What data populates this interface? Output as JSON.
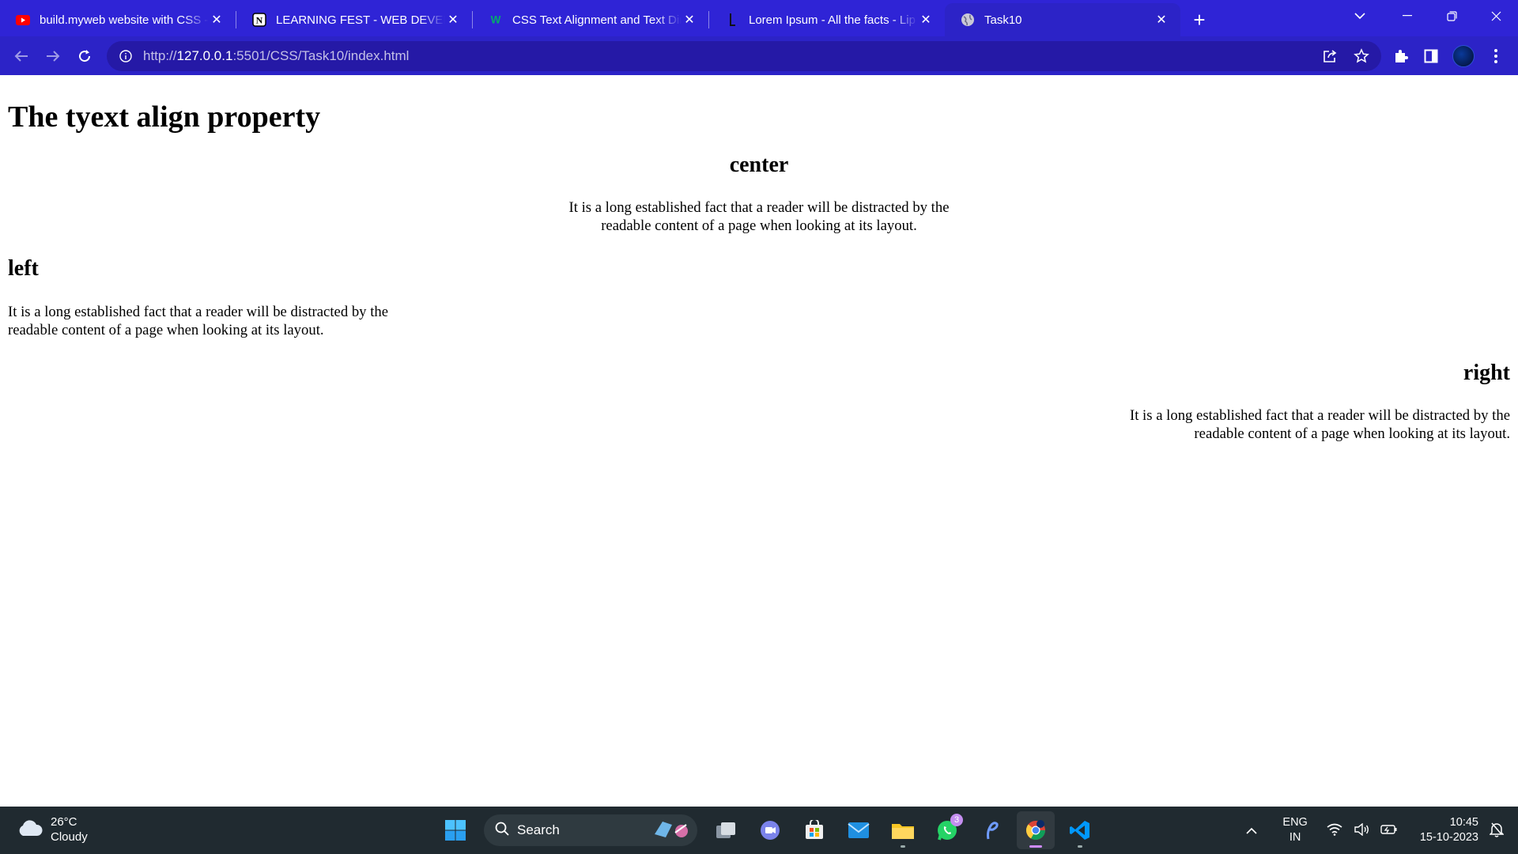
{
  "browser": {
    "tabs": [
      {
        "title": "build.myweb website with CSS -",
        "favicon": "youtube-icon"
      },
      {
        "title": "LEARNING FEST - WEB DEVELOPER",
        "favicon": "notion-icon"
      },
      {
        "title": "CSS Text Alignment and Text Dir",
        "favicon": "w3schools-icon"
      },
      {
        "title": "Lorem Ipsum - All the facts - Lip",
        "favicon": "lipsum-icon"
      },
      {
        "title": "Task10",
        "favicon": "globe-icon",
        "active": true
      }
    ],
    "url_host": "127.0.0.1",
    "url_scheme": "http://",
    "url_rest": ":5501/CSS/Task10/index.html"
  },
  "page": {
    "heading": "The tyext align property",
    "center": {
      "heading": "center",
      "text": "It is a long established fact that a reader will be distracted by the readable content of a page when looking at its layout."
    },
    "left": {
      "heading": "left",
      "text": "It is a long established fact that a reader will be distracted by the readable content of a page when looking at its layout."
    },
    "right": {
      "heading": "right",
      "text": "It is a long established fact that a reader will be distracted by the readable content of a page when looking at its layout."
    }
  },
  "taskbar": {
    "weather_temp": "26°C",
    "weather_desc": "Cloudy",
    "search_label": "Search",
    "whatsapp_badge": "3",
    "lang_top": "ENG",
    "lang_bottom": "IN",
    "time": "10:45",
    "date": "15-10-2023"
  },
  "colors": {
    "chrome_frame": "#2f24d6",
    "chrome_toolbar": "#2c23c7",
    "omnibox": "#2519a6",
    "taskbar": "#202a30"
  }
}
